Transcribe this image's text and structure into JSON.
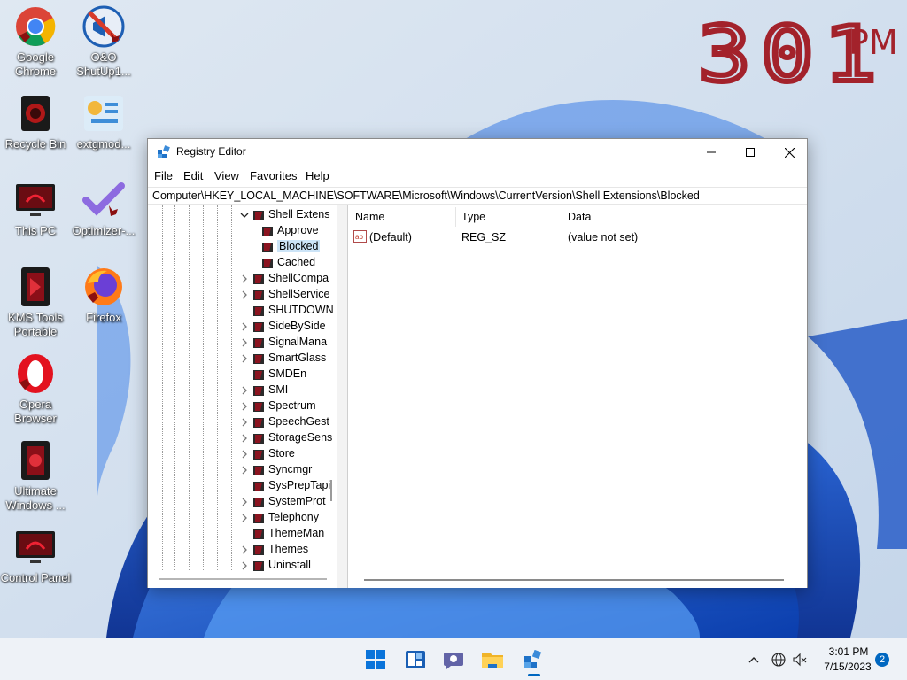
{
  "desktop": {
    "clock": {
      "digits": "301",
      "ampm": "PM"
    },
    "icons": [
      {
        "label": "Google Chrome",
        "icon": "chrome-icon"
      },
      {
        "label": "O&O ShutUp1...",
        "icon": "shutup-icon"
      },
      {
        "label": "Recycle Bin",
        "icon": "recycle-bin-icon"
      },
      {
        "label": "extgmod...",
        "icon": "extgmod-icon"
      },
      {
        "label": "This PC",
        "icon": "monitor-icon"
      },
      {
        "label": "Optimizer-...",
        "icon": "optimizer-icon"
      },
      {
        "label": "KMS Tools Portable",
        "icon": "kms-tools-icon"
      },
      {
        "label": "Firefox",
        "icon": "firefox-icon"
      },
      {
        "label": "Opera Browser",
        "icon": "opera-icon"
      },
      {
        "label": "Ultimate Windows ...",
        "icon": "ultimate-windows-icon"
      },
      {
        "label": "Control Panel",
        "icon": "monitor-icon"
      }
    ]
  },
  "window": {
    "title": "Registry Editor",
    "menu": [
      "File",
      "Edit",
      "View",
      "Favorites",
      "Help"
    ],
    "address": "Computer\\HKEY_LOCAL_MACHINE\\SOFTWARE\\Microsoft\\Windows\\CurrentVersion\\Shell Extensions\\Blocked",
    "tree": [
      {
        "label": "Shell Extens",
        "expanded": true
      },
      {
        "label": "Approve"
      },
      {
        "label": "Blocked",
        "selected": true
      },
      {
        "label": "Cached"
      },
      {
        "label": "ShellCompa"
      },
      {
        "label": "ShellService"
      },
      {
        "label": "SHUTDOWN"
      },
      {
        "label": "SideBySide"
      },
      {
        "label": "SignalMana"
      },
      {
        "label": "SmartGlass"
      },
      {
        "label": "SMDEn"
      },
      {
        "label": "SMI"
      },
      {
        "label": "Spectrum"
      },
      {
        "label": "SpeechGest"
      },
      {
        "label": "StorageSens"
      },
      {
        "label": "Store"
      },
      {
        "label": "Syncmgr"
      },
      {
        "label": "SysPrepTapi"
      },
      {
        "label": "SystemProt"
      },
      {
        "label": "Telephony"
      },
      {
        "label": "ThemeMan"
      },
      {
        "label": "Themes"
      },
      {
        "label": "Uninstall"
      }
    ],
    "columns": {
      "name": "Name",
      "type": "Type",
      "data": "Data"
    },
    "values": [
      {
        "name": "(Default)",
        "type": "REG_SZ",
        "data": "(value not set)"
      }
    ]
  },
  "taskbar": {
    "time": "3:01 PM",
    "date": "7/15/2023",
    "notifications": "2"
  }
}
